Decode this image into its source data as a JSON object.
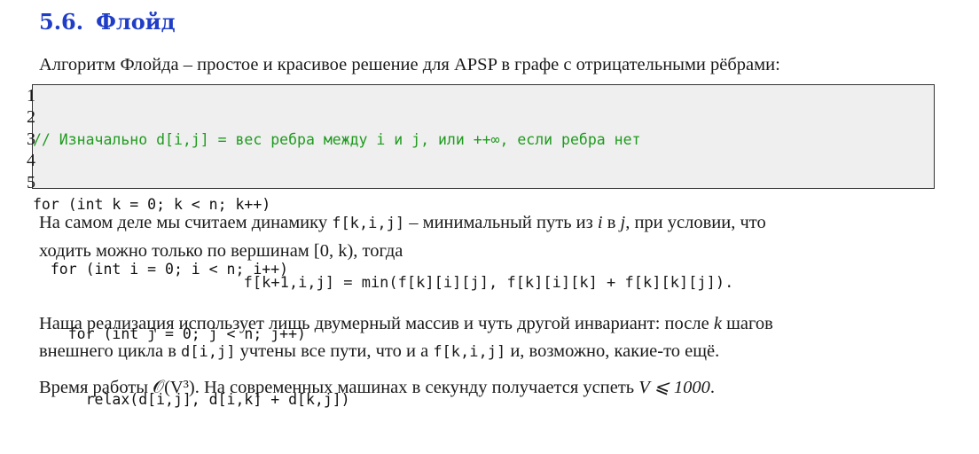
{
  "section": {
    "number": "5.6.",
    "title": "Флойд"
  },
  "intro": "Алгоритм Флойда – простое и красивое решение для APSP в графе с отрицательными рёбрами:",
  "code": {
    "line_numbers": [
      "1",
      "2",
      "3",
      "4",
      "5"
    ],
    "lines": [
      "// Изначально d[i,j] = вес ребра между i и j, или ++∞, если ребра нет",
      "for (int k = 0; k < n; k++)",
      "  for (int i = 0; i < n; i++)",
      "    for (int j = 0; j < n; j++)",
      "      relax(d[i,j], d[i,k] + d[k,j])"
    ],
    "comment_color": "#1f9b1f",
    "background_color": "#efefef"
  },
  "para2": {
    "text1": "На самом деле мы считаем динамику ",
    "code1": "f[k,i,j]",
    "text2": " – минимальный путь из ",
    "var_i": "i",
    "text3": " в ",
    "var_j": "j",
    "text4": ", при условии, что",
    "line2": "ходить можно только по вершинам [0, k), тогда"
  },
  "formula": "f[k+1,i,j] = min(f[k][i][j], f[k][i][k] + f[k][k][j]).",
  "para3": {
    "text1": "Наша реализация использует лишь двумерный массив и чуть другой инвариант: после ",
    "var_k": "k",
    "text2": " шагов",
    "line2_text1": "внешнего цикла в ",
    "line2_code1": "d[i,j]",
    "line2_text2": " учтены все пути, что и а ",
    "line2_code2": "f[k,i,j]",
    "line2_text3": " и, возможно, какие-то ещё."
  },
  "para4": {
    "text1": "Время работы ",
    "complexity": "𝒪(V³)",
    "text2": ". На современных машинах в секунду получается успеть ",
    "limit": "V ⩽ 1000",
    "text3": "."
  },
  "colors": {
    "title": "#1f3dc7"
  }
}
